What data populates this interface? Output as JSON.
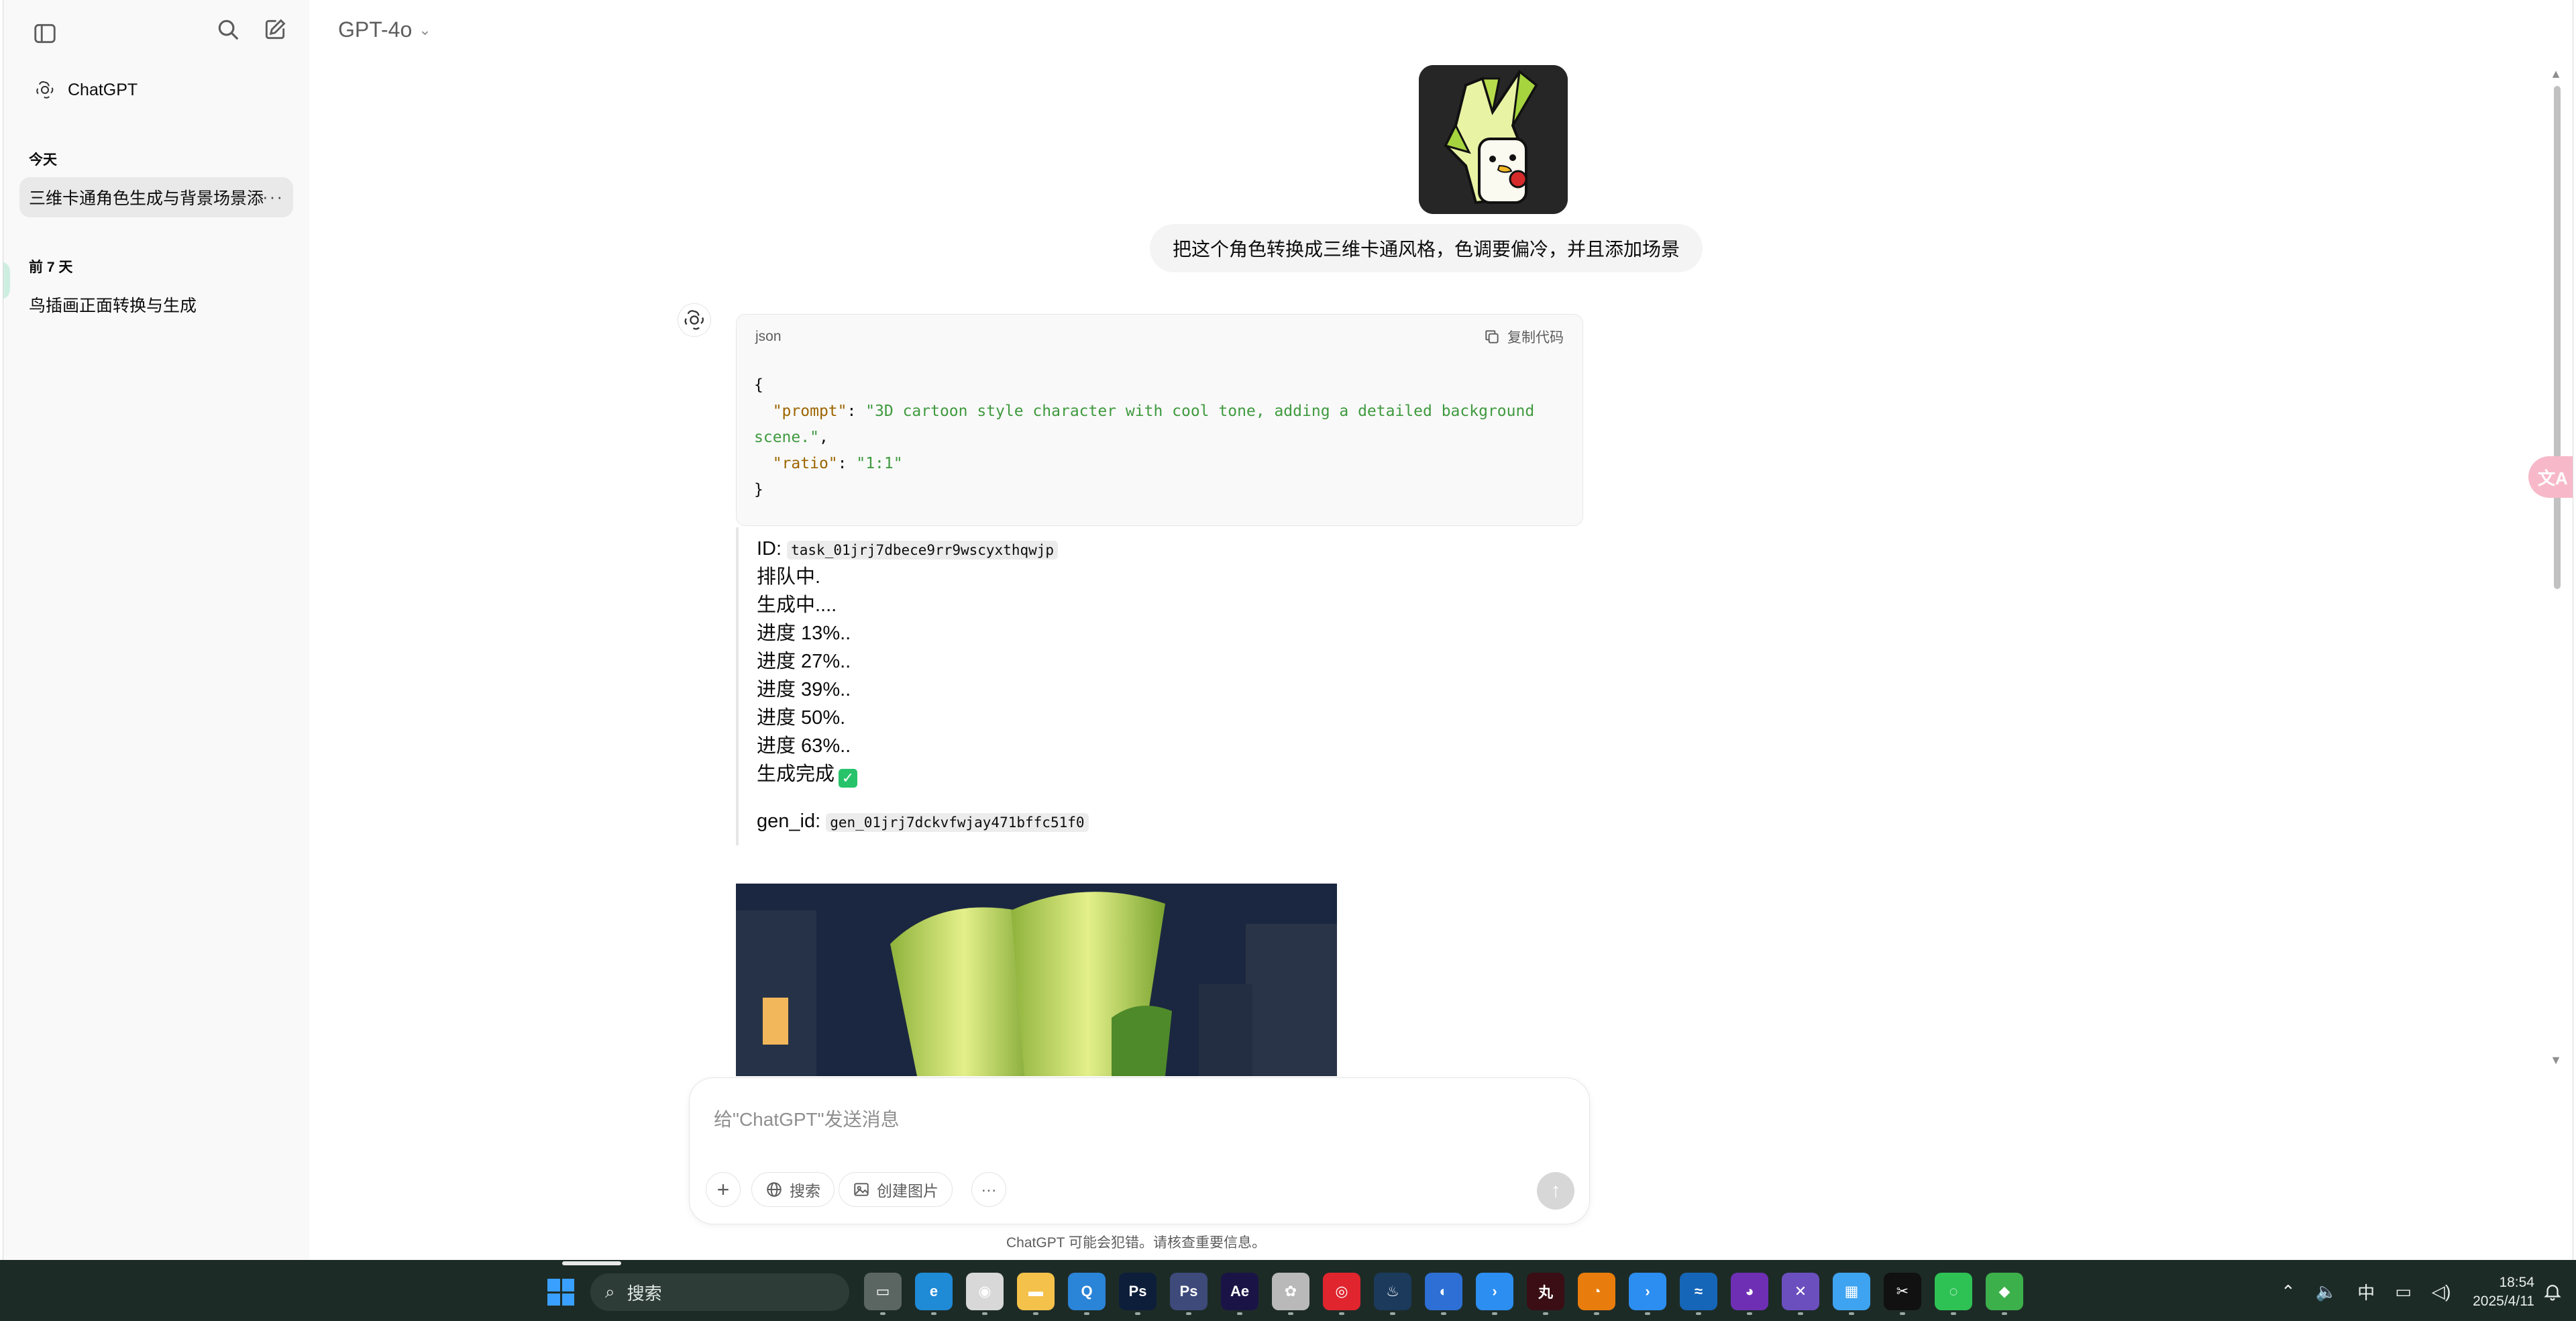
{
  "sidebar": {
    "brand_label": "ChatGPT",
    "section_today": "今天",
    "today_item": "三维卡通角色生成与背景场景添加",
    "section_week": "前 7 天",
    "week_item": "鸟插画正面转换与生成",
    "more_glyph": "···"
  },
  "header": {
    "model_name": "GPT-4o",
    "model_chevron": "⌄"
  },
  "conversation": {
    "user_message": "把这个角色转换成三维卡通风格，色调要偏冷，并且添加场景",
    "code": {
      "language": "json",
      "copy_label": "复制代码",
      "open_brace": "{",
      "prompt_key": "\"prompt\"",
      "prompt_value": "\"3D cartoon style character with cool tone, adding a detailed background scene.\"",
      "ratio_key": "\"ratio\"",
      "ratio_value": "\"1:1\"",
      "close_brace": "}"
    },
    "task_id_label": "ID:",
    "task_id": "task_01jrj7dbece9rr9wscyxthqwjp",
    "status_lines": [
      "排队中.",
      "生成中....",
      "进度 13%..",
      "进度 27%..",
      "进度 39%..",
      "进度 50%.",
      "进度 63%..",
      "生成完成"
    ],
    "gen_id_label": "gen_id:",
    "gen_id": "gen_01jrj7dckvfwjay471bffc51f0"
  },
  "composer": {
    "placeholder": "给\"ChatGPT\"发送消息",
    "plus_label": "+",
    "search_label": "搜索",
    "create_image_label": "创建图片",
    "more_label": "···",
    "disclaimer": "ChatGPT 可能会犯错。请核查重要信息。"
  },
  "taskbar": {
    "search_placeholder": "搜索",
    "tray_ime": "中",
    "time": "18:54",
    "date": "2025/4/11",
    "apps": [
      {
        "name": "task-view",
        "glyph": "▭",
        "color": "#5b6663"
      },
      {
        "name": "edge",
        "glyph": "e",
        "color": "#1f8ad6"
      },
      {
        "name": "app-circle",
        "glyph": "◉",
        "color": "#d8d8d8"
      },
      {
        "name": "file-explorer",
        "glyph": "▬",
        "color": "#f4c14a"
      },
      {
        "name": "search-tool",
        "glyph": "Q",
        "color": "#2a84d8"
      },
      {
        "name": "photoshop",
        "glyph": "Ps",
        "color": "#0d1e3a"
      },
      {
        "name": "photoshop-alt",
        "glyph": "Ps",
        "color": "#3d4a7a"
      },
      {
        "name": "after-effects",
        "glyph": "Ae",
        "color": "#1a1446"
      },
      {
        "name": "davinci",
        "glyph": "✿",
        "color": "#b9b9b9"
      },
      {
        "name": "netease-music",
        "glyph": "◎",
        "color": "#e0252e"
      },
      {
        "name": "steam",
        "glyph": "♨",
        "color": "#1b3a5c"
      },
      {
        "name": "blue-app",
        "glyph": "◐",
        "color": "#2d6fd4"
      },
      {
        "name": "arrow-app",
        "glyph": "›",
        "color": "#2b8ef0"
      },
      {
        "name": "red-app",
        "glyph": "丸",
        "color": "#3a0e14"
      },
      {
        "name": "blender",
        "glyph": "◔",
        "color": "#e87d0d"
      },
      {
        "name": "arrow-app-2",
        "glyph": "›",
        "color": "#2b8ef0"
      },
      {
        "name": "wave-app",
        "glyph": "≈",
        "color": "#1566b8"
      },
      {
        "name": "github",
        "glyph": "◕",
        "color": "#6e2fb5"
      },
      {
        "name": "x-app",
        "glyph": "✕",
        "color": "#6b4fbf"
      },
      {
        "name": "grid-app",
        "glyph": "▦",
        "color": "#3ea3f0"
      },
      {
        "name": "capcut",
        "glyph": "✂",
        "color": "#111111"
      },
      {
        "name": "wechat",
        "glyph": "◌",
        "color": "#2ec255"
      },
      {
        "name": "multi-app",
        "glyph": "◆",
        "color": "#3cb04a"
      }
    ]
  }
}
